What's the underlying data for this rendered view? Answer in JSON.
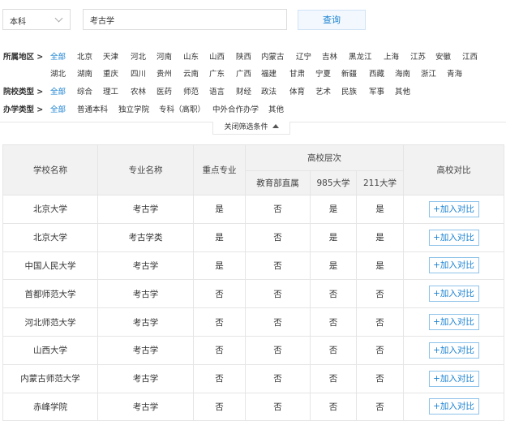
{
  "search": {
    "level_value": "本科",
    "query": "考古学",
    "button_label": "查询"
  },
  "filters": {
    "region": {
      "label": "所属地区 >",
      "options": [
        "全部",
        "北京",
        "天津",
        "河北",
        "河南",
        "山东",
        "山西",
        "陕西",
        "内蒙古",
        "辽宁",
        "吉林",
        "黑龙江",
        "上海",
        "江苏",
        "安徽",
        "江西",
        "湖北",
        "湖南",
        "重庆",
        "四川",
        "贵州",
        "云南",
        "广东",
        "广西",
        "福建",
        "甘肃",
        "宁夏",
        "新疆",
        "西藏",
        "海南",
        "浙江",
        "青海"
      ]
    },
    "school_type": {
      "label": "院校类型 >",
      "options": [
        "全部",
        "综合",
        "理工",
        "农林",
        "医药",
        "师范",
        "语言",
        "财经",
        "政法",
        "体育",
        "艺术",
        "民族",
        "军事",
        "其他"
      ]
    },
    "run_type": {
      "label": "办学类型 >",
      "options": [
        "全部",
        "普通本科",
        "独立学院",
        "专科（高职）",
        "中外合作办学",
        "其他"
      ]
    },
    "collapse_label": "关闭筛选条件"
  },
  "table": {
    "headers": {
      "school": "学校名称",
      "major": "专业名称",
      "key_major": "重点专业",
      "level_group": "高校层次",
      "moe": "教育部直属",
      "p985": "985大学",
      "p211": "211大学",
      "compare": "高校对比"
    },
    "add_label": "+加入对比",
    "rows": [
      {
        "school": "北京大学",
        "major": "考古学",
        "key": "是",
        "moe": "否",
        "p985": "是",
        "p211": "是"
      },
      {
        "school": "北京大学",
        "major": "考古学类",
        "key": "是",
        "moe": "否",
        "p985": "是",
        "p211": "是"
      },
      {
        "school": "中国人民大学",
        "major": "考古学",
        "key": "是",
        "moe": "否",
        "p985": "是",
        "p211": "是"
      },
      {
        "school": "首都师范大学",
        "major": "考古学",
        "key": "否",
        "moe": "否",
        "p985": "否",
        "p211": "否"
      },
      {
        "school": "河北师范大学",
        "major": "考古学",
        "key": "否",
        "moe": "否",
        "p985": "否",
        "p211": "否"
      },
      {
        "school": "山西大学",
        "major": "考古学",
        "key": "否",
        "moe": "否",
        "p985": "否",
        "p211": "否"
      },
      {
        "school": "内蒙古师范大学",
        "major": "考古学",
        "key": "否",
        "moe": "否",
        "p985": "否",
        "p211": "否"
      },
      {
        "school": "赤峰学院",
        "major": "考古学",
        "key": "否",
        "moe": "否",
        "p985": "否",
        "p211": "否"
      }
    ]
  },
  "colors": {
    "accent": "#1b82d2",
    "header_bg": "#f2f2f2",
    "border": "#e5e5e5"
  }
}
